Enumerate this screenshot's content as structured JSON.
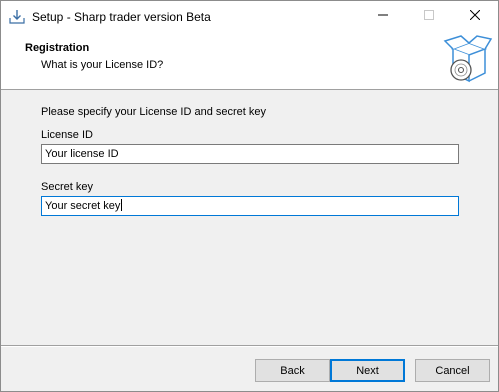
{
  "window": {
    "title": "Setup - Sharp trader version Beta",
    "icons": {
      "app": "install-download-icon",
      "minimize": "minimize-icon",
      "maximize": "maximize-icon",
      "close": "close-icon"
    }
  },
  "header": {
    "title": "Registration",
    "subtitle": "What is your License ID?",
    "logo": "software-box-cd-icon"
  },
  "form": {
    "instruction": "Please specify your License ID and secret key",
    "license_label": "License ID",
    "license_value": "Your license ID",
    "secret_label": "Secret key",
    "secret_value": "Your secret key"
  },
  "buttons": {
    "back": "Back",
    "next": "Next",
    "cancel": "Cancel"
  },
  "colors": {
    "focus_accent": "#0078d7",
    "logo_blue": "#3d8fd8"
  }
}
